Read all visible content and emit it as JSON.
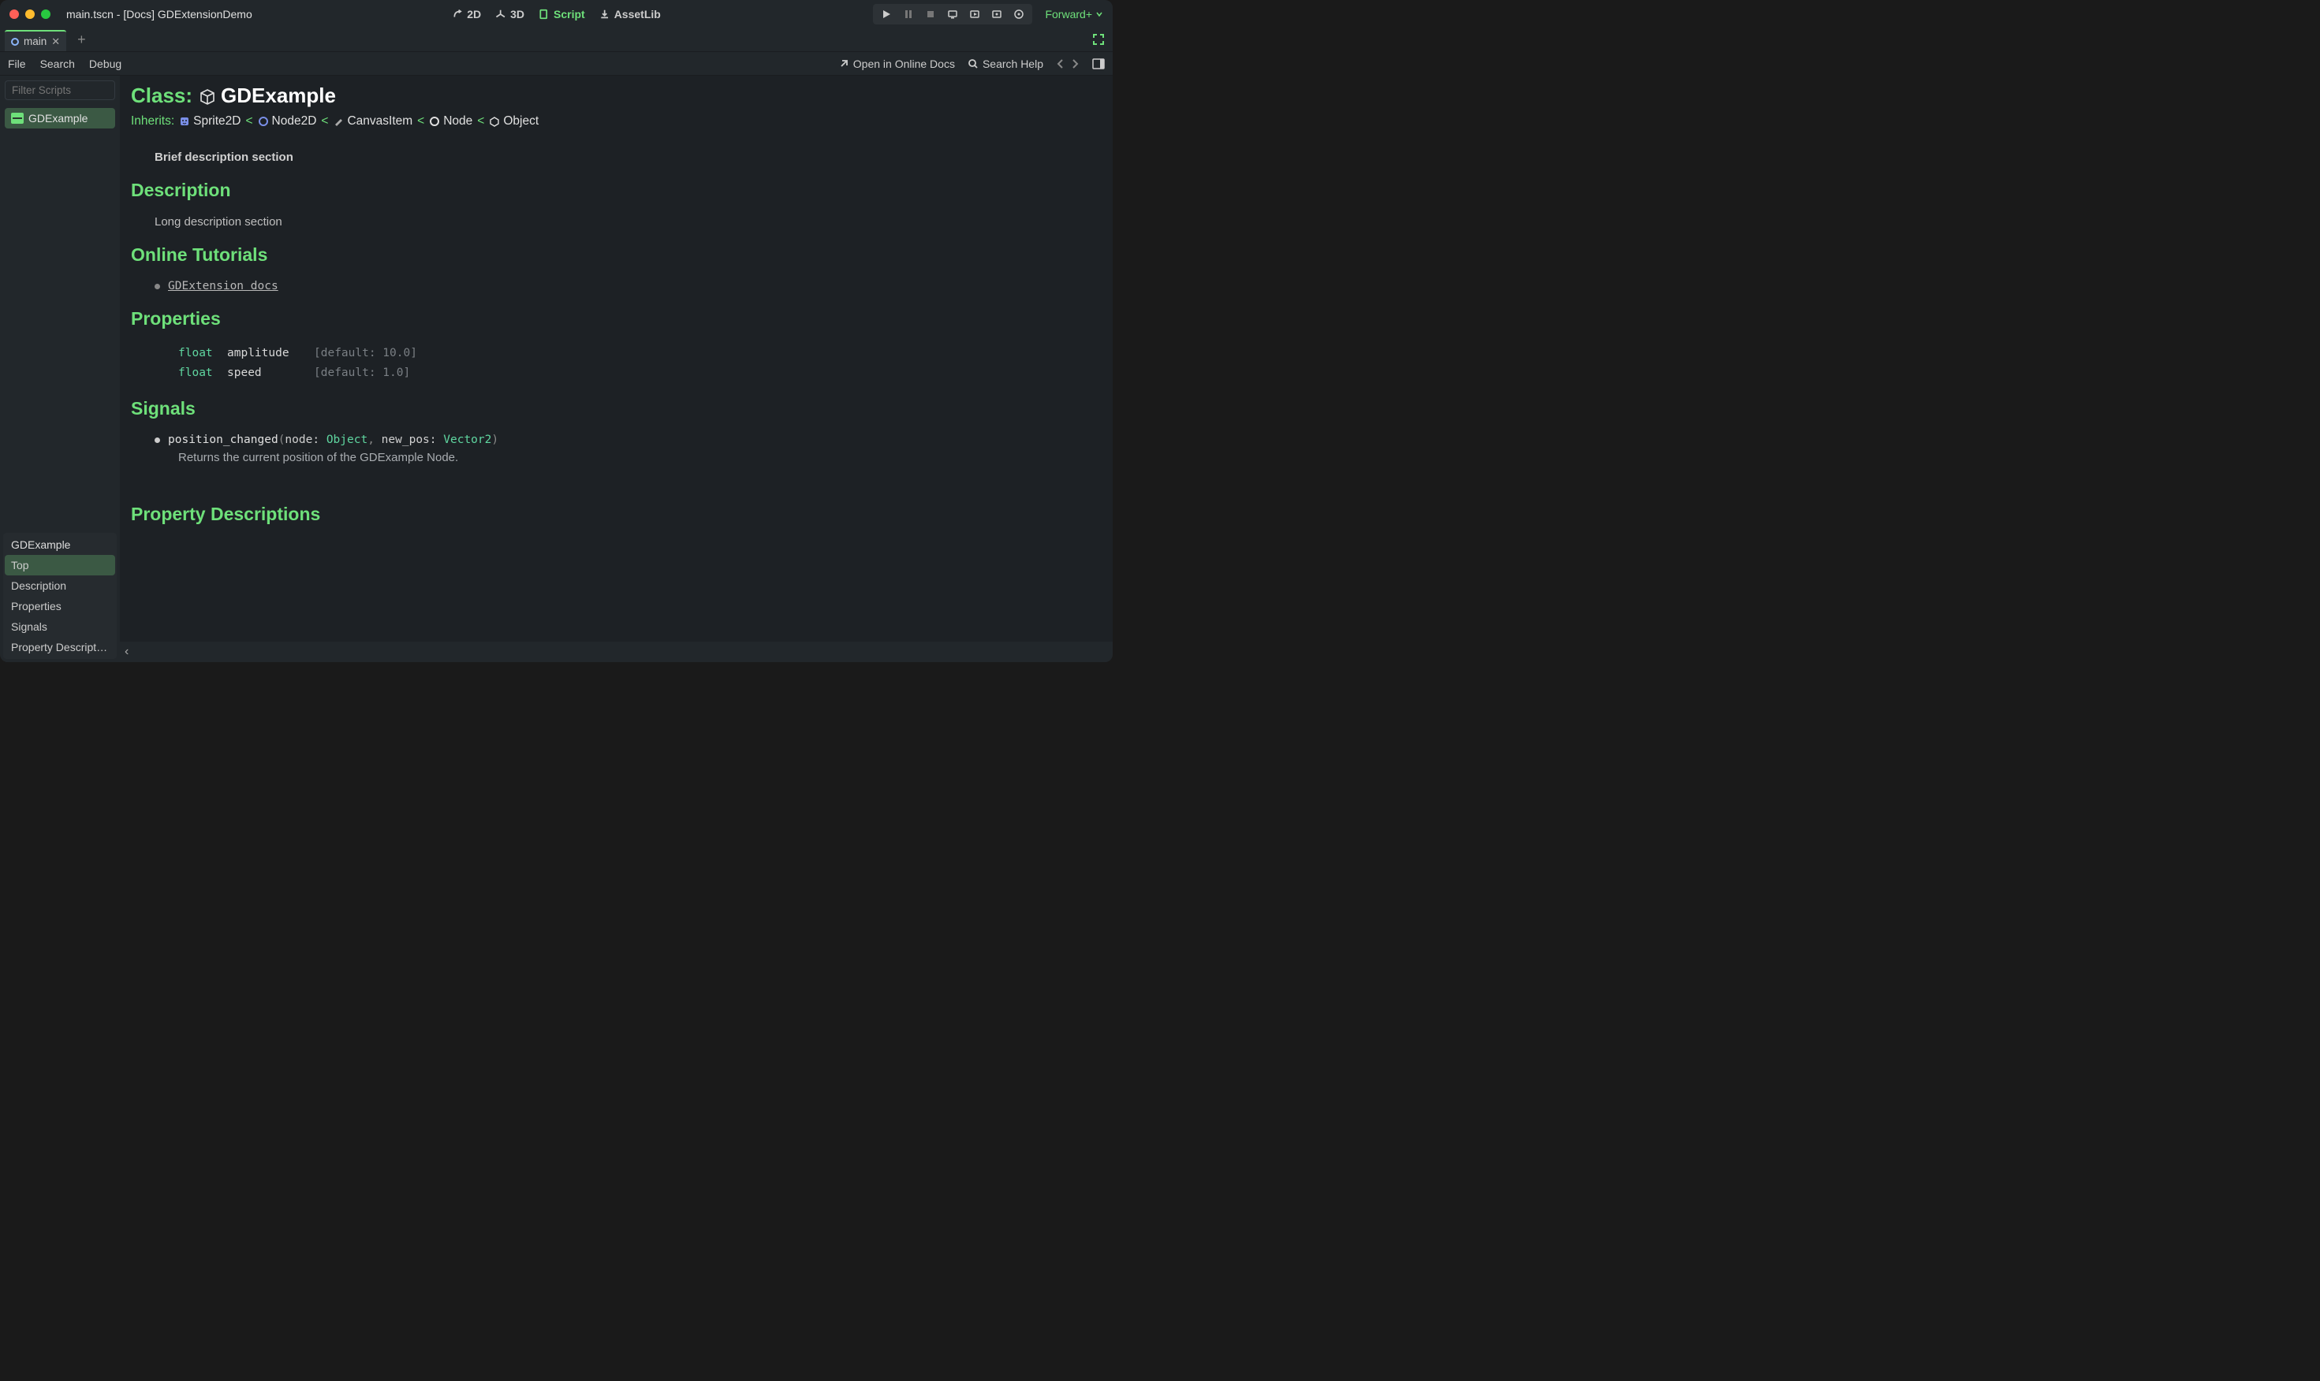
{
  "window": {
    "title": "main.tscn - [Docs] GDExtensionDemo"
  },
  "topbar": {
    "mode_2d": "2D",
    "mode_3d": "3D",
    "mode_script": "Script",
    "asset_lib": "AssetLib",
    "renderer": "Forward+"
  },
  "scene_tab": {
    "name": "main"
  },
  "menubar": {
    "file": "File",
    "search": "Search",
    "debug": "Debug",
    "open_online": "Open in Online Docs",
    "search_help": "Search Help"
  },
  "left_panel": {
    "filter_placeholder": "Filter Scripts",
    "script_item": "GDExample",
    "outline_header": "GDExample",
    "outline": {
      "top": "Top",
      "description": "Description",
      "properties": "Properties",
      "signals": "Signals",
      "prop_desc": "Property Descript…"
    }
  },
  "doc": {
    "class_label": "Class:",
    "class_name": "GDExample",
    "inherits_label": "Inherits:",
    "chain": {
      "sprite2d": "Sprite2D",
      "node2d": "Node2D",
      "canvasitem": "CanvasItem",
      "node": "Node",
      "object": "Object"
    },
    "brief": "Brief description section",
    "desc_heading": "Description",
    "long_desc": "Long description section",
    "tutorials_heading": "Online Tutorials",
    "tutorial_link": "GDExtension docs",
    "props_heading": "Properties",
    "props": [
      {
        "type": "float",
        "name": "amplitude",
        "default": "[default: 10.0]"
      },
      {
        "type": "float",
        "name": "speed",
        "default": "[default: 1.0]"
      }
    ],
    "signals_heading": "Signals",
    "signal": {
      "name": "position_changed",
      "p1": "node:",
      "t1": "Object",
      "sep": ",",
      "p2": "new_pos:",
      "t2": "Vector2",
      "desc": "Returns the current position of the GDExample Node."
    },
    "prop_desc_heading": "Property Descriptions"
  }
}
